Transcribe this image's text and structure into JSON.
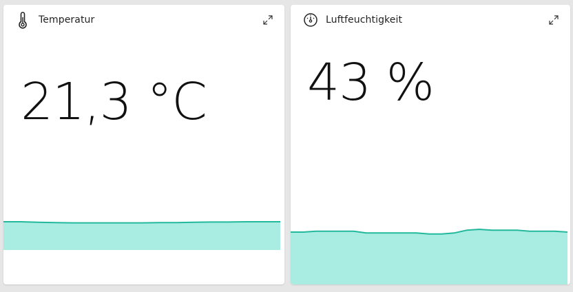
{
  "colors": {
    "accent_line": "#22b89c",
    "accent_fill": "#a9ede2",
    "background": "#e6e6e6"
  },
  "temperature_card": {
    "title": "Temperatur",
    "icon": "thermometer-icon",
    "value": "21,3 °C",
    "expand_icon": "expand-icon",
    "history": [
      0.5,
      0.5,
      0.48,
      0.47,
      0.46,
      0.46,
      0.46,
      0.46,
      0.46,
      0.47,
      0.47,
      0.48,
      0.49,
      0.49,
      0.5,
      0.5,
      0.5
    ]
  },
  "humidity_card": {
    "title": "Luftfeuchtigkeit",
    "icon": "gauge-icon",
    "value": "43 %",
    "expand_icon": "expand-icon",
    "history": [
      0.51,
      0.51,
      0.52,
      0.52,
      0.52,
      0.52,
      0.5,
      0.5,
      0.5,
      0.5,
      0.5,
      0.49,
      0.49,
      0.5,
      0.53,
      0.54,
      0.53,
      0.53,
      0.53,
      0.52,
      0.52,
      0.52,
      0.51
    ]
  }
}
